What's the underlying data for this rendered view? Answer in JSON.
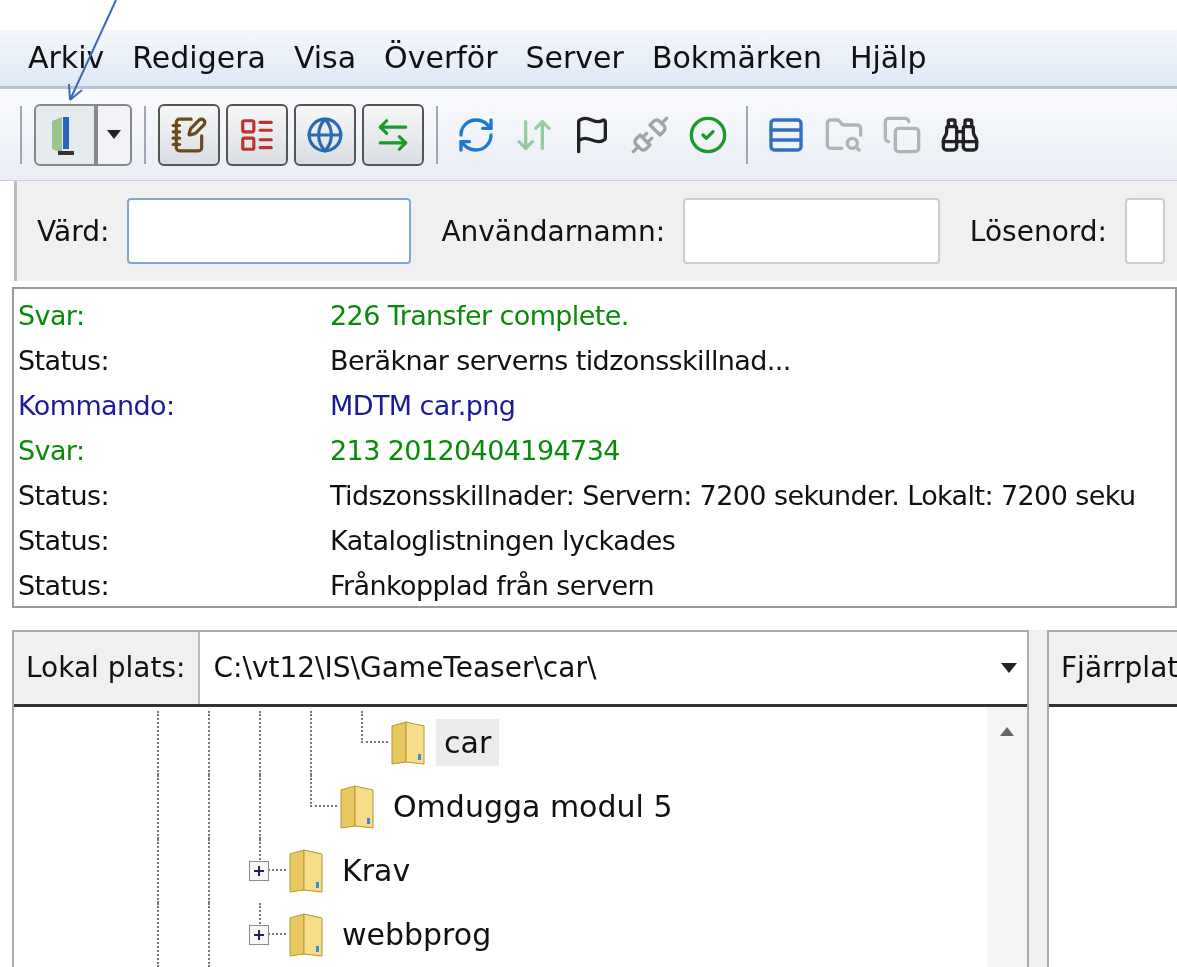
{
  "menu": [
    {
      "label": "Arkiv"
    },
    {
      "label": "Redigera"
    },
    {
      "label": "Visa"
    },
    {
      "label": "Överför"
    },
    {
      "label": "Server"
    },
    {
      "label": "Bokmärken"
    },
    {
      "label": "Hjälp"
    }
  ],
  "toolbar": {
    "toggles": [
      {
        "on": true
      },
      {
        "on": true
      },
      {
        "on": true
      },
      {
        "on": true
      }
    ],
    "actions": [
      {
        "disabled": false
      },
      {
        "disabled": true
      },
      {
        "disabled": false
      },
      {
        "disabled": true
      },
      {
        "disabled": false
      },
      {
        "disabled": false
      },
      {
        "disabled": true
      },
      {
        "disabled": true
      },
      {
        "disabled": false
      }
    ]
  },
  "quickconnect": {
    "fields": [
      {
        "label": "Värd:"
      },
      {
        "label": "Användarnamn:"
      },
      {
        "label": "Lösenord:"
      }
    ]
  },
  "log": [
    {
      "kind": "response",
      "type": "Svar:",
      "message": "226 Transfer complete."
    },
    {
      "kind": "status",
      "type": "Status:",
      "message": "Beräknar serverns tidzonsskillnad..."
    },
    {
      "kind": "command",
      "type": "Kommando:",
      "message": "MDTM car.png"
    },
    {
      "kind": "response",
      "type": "Svar:",
      "message": "213 20120404194734"
    },
    {
      "kind": "status",
      "type": "Status:",
      "message": "Tidszonsskillnader: Servern: 7200 sekunder. Lokalt: 7200 seku"
    },
    {
      "kind": "status",
      "type": "Status:",
      "message": "Kataloglistningen lyckades"
    },
    {
      "kind": "status",
      "type": "Status:",
      "message": "Frånkopplad från servern"
    }
  ],
  "local": {
    "label": "Lokal plats:",
    "path": "C:\\vt12\\IS\\GameTeaser\\car\\",
    "tree": [
      {
        "children": [
          {
            "children": [
              {
                "label": "car",
                "selected": true
              }
            ]
          },
          {
            "label": "Omdugga modul 5",
            "selected": false
          }
        ]
      },
      {
        "label": "Krav",
        "selected": false,
        "expanded": false
      },
      {
        "label": "webbprog",
        "selected": false,
        "expanded": false
      }
    ]
  },
  "remote": {
    "label": "Fjärrplat"
  }
}
